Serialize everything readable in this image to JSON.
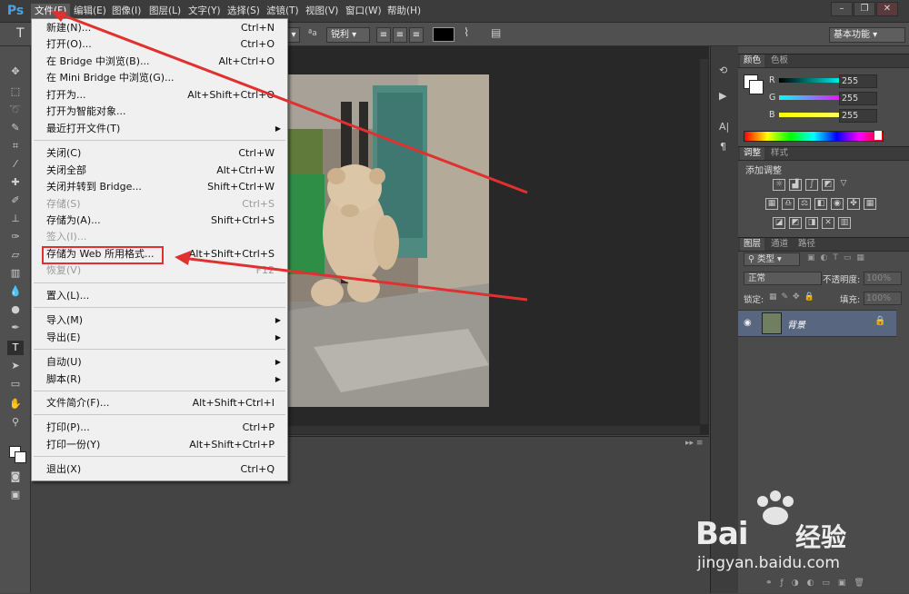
{
  "menubar": {
    "logo": "Ps",
    "items": [
      "文件(F)",
      "编辑(E)",
      "图像(I)",
      "图层(L)",
      "文字(Y)",
      "选择(S)",
      "滤镜(T)",
      "视图(V)",
      "窗口(W)",
      "帮助(H)"
    ]
  },
  "options": {
    "tool_glyph": "T",
    "aa_label": "ªa",
    "aa_mode": "锐利",
    "workspace": "基本功能"
  },
  "panels": {
    "color_tabs": [
      "颜色",
      "色板"
    ],
    "rgb": [
      {
        "label": "R",
        "value": "255",
        "color": "#00ffff"
      },
      {
        "label": "G",
        "value": "255",
        "color": "#ff00ff"
      },
      {
        "label": "B",
        "value": "255",
        "color": "#ffff00"
      }
    ],
    "adjust_tabs": [
      "调整",
      "样式"
    ],
    "adjust_title": "添加调整",
    "layers_tabs": [
      "图层",
      "通道",
      "路径"
    ],
    "filter_kind": "类型",
    "blend_mode": "正常",
    "opacity_label": "不透明度:",
    "opacity_value": "100%",
    "lock_label": "锁定:",
    "fill_label": "填充:",
    "fill_value": "100%",
    "layer_name": "背景"
  },
  "file_menu": {
    "items": [
      {
        "label": "新建(N)...",
        "shortcut": "Ctrl+N"
      },
      {
        "label": "打开(O)...",
        "shortcut": "Ctrl+O"
      },
      {
        "label": "在 Bridge 中浏览(B)...",
        "shortcut": "Alt+Ctrl+O"
      },
      {
        "label": "在 Mini Bridge 中浏览(G)...",
        "shortcut": ""
      },
      {
        "label": "打开为...",
        "shortcut": "Alt+Shift+Ctrl+O"
      },
      {
        "label": "打开为智能对象...",
        "shortcut": ""
      },
      {
        "label": "最近打开文件(T)",
        "shortcut": ""
      },
      {
        "label": "关闭(C)",
        "shortcut": "Ctrl+W"
      },
      {
        "label": "关闭全部",
        "shortcut": "Alt+Ctrl+W"
      },
      {
        "label": "关闭并转到 Bridge...",
        "shortcut": "Shift+Ctrl+W"
      },
      {
        "label": "存储(S)",
        "shortcut": "Ctrl+S"
      },
      {
        "label": "存储为(A)...",
        "shortcut": "Shift+Ctrl+S"
      },
      {
        "label": "签入(I)...",
        "shortcut": ""
      },
      {
        "label": "存储为 Web 所用格式...",
        "shortcut": "Alt+Shift+Ctrl+S"
      },
      {
        "label": "恢复(V)",
        "shortcut": "F12"
      },
      {
        "label": "置入(L)...",
        "shortcut": ""
      },
      {
        "label": "导入(M)",
        "shortcut": ""
      },
      {
        "label": "导出(E)",
        "shortcut": ""
      },
      {
        "label": "自动(U)",
        "shortcut": ""
      },
      {
        "label": "脚本(R)",
        "shortcut": ""
      },
      {
        "label": "文件简介(F)...",
        "shortcut": "Alt+Shift+Ctrl+I"
      },
      {
        "label": "打印(P)...",
        "shortcut": "Ctrl+P"
      },
      {
        "label": "打印一份(Y)",
        "shortcut": "Alt+Shift+Ctrl+P"
      },
      {
        "label": "退出(X)",
        "shortcut": "Ctrl+Q"
      }
    ]
  },
  "watermark": {
    "brand_left": "Bai",
    "brand_right": "经验",
    "url": "jingyan.baidu.com"
  },
  "colors": {
    "annotation": "#e03030",
    "accent": "#4aa3df"
  }
}
